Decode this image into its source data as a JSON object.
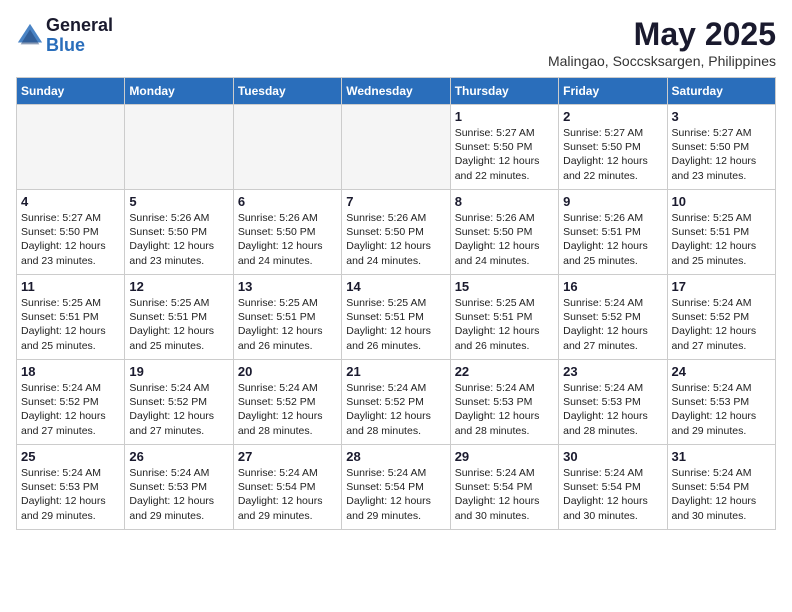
{
  "header": {
    "logo_general": "General",
    "logo_blue": "Blue",
    "month_year": "May 2025",
    "location": "Malingao, Soccsksargen, Philippines"
  },
  "weekdays": [
    "Sunday",
    "Monday",
    "Tuesday",
    "Wednesday",
    "Thursday",
    "Friday",
    "Saturday"
  ],
  "weeks": [
    [
      {
        "day": "",
        "info": ""
      },
      {
        "day": "",
        "info": ""
      },
      {
        "day": "",
        "info": ""
      },
      {
        "day": "",
        "info": ""
      },
      {
        "day": "1",
        "info": "Sunrise: 5:27 AM\nSunset: 5:50 PM\nDaylight: 12 hours\nand 22 minutes."
      },
      {
        "day": "2",
        "info": "Sunrise: 5:27 AM\nSunset: 5:50 PM\nDaylight: 12 hours\nand 22 minutes."
      },
      {
        "day": "3",
        "info": "Sunrise: 5:27 AM\nSunset: 5:50 PM\nDaylight: 12 hours\nand 23 minutes."
      }
    ],
    [
      {
        "day": "4",
        "info": "Sunrise: 5:27 AM\nSunset: 5:50 PM\nDaylight: 12 hours\nand 23 minutes."
      },
      {
        "day": "5",
        "info": "Sunrise: 5:26 AM\nSunset: 5:50 PM\nDaylight: 12 hours\nand 23 minutes."
      },
      {
        "day": "6",
        "info": "Sunrise: 5:26 AM\nSunset: 5:50 PM\nDaylight: 12 hours\nand 24 minutes."
      },
      {
        "day": "7",
        "info": "Sunrise: 5:26 AM\nSunset: 5:50 PM\nDaylight: 12 hours\nand 24 minutes."
      },
      {
        "day": "8",
        "info": "Sunrise: 5:26 AM\nSunset: 5:50 PM\nDaylight: 12 hours\nand 24 minutes."
      },
      {
        "day": "9",
        "info": "Sunrise: 5:26 AM\nSunset: 5:51 PM\nDaylight: 12 hours\nand 25 minutes."
      },
      {
        "day": "10",
        "info": "Sunrise: 5:25 AM\nSunset: 5:51 PM\nDaylight: 12 hours\nand 25 minutes."
      }
    ],
    [
      {
        "day": "11",
        "info": "Sunrise: 5:25 AM\nSunset: 5:51 PM\nDaylight: 12 hours\nand 25 minutes."
      },
      {
        "day": "12",
        "info": "Sunrise: 5:25 AM\nSunset: 5:51 PM\nDaylight: 12 hours\nand 25 minutes."
      },
      {
        "day": "13",
        "info": "Sunrise: 5:25 AM\nSunset: 5:51 PM\nDaylight: 12 hours\nand 26 minutes."
      },
      {
        "day": "14",
        "info": "Sunrise: 5:25 AM\nSunset: 5:51 PM\nDaylight: 12 hours\nand 26 minutes."
      },
      {
        "day": "15",
        "info": "Sunrise: 5:25 AM\nSunset: 5:51 PM\nDaylight: 12 hours\nand 26 minutes."
      },
      {
        "day": "16",
        "info": "Sunrise: 5:24 AM\nSunset: 5:52 PM\nDaylight: 12 hours\nand 27 minutes."
      },
      {
        "day": "17",
        "info": "Sunrise: 5:24 AM\nSunset: 5:52 PM\nDaylight: 12 hours\nand 27 minutes."
      }
    ],
    [
      {
        "day": "18",
        "info": "Sunrise: 5:24 AM\nSunset: 5:52 PM\nDaylight: 12 hours\nand 27 minutes."
      },
      {
        "day": "19",
        "info": "Sunrise: 5:24 AM\nSunset: 5:52 PM\nDaylight: 12 hours\nand 27 minutes."
      },
      {
        "day": "20",
        "info": "Sunrise: 5:24 AM\nSunset: 5:52 PM\nDaylight: 12 hours\nand 28 minutes."
      },
      {
        "day": "21",
        "info": "Sunrise: 5:24 AM\nSunset: 5:52 PM\nDaylight: 12 hours\nand 28 minutes."
      },
      {
        "day": "22",
        "info": "Sunrise: 5:24 AM\nSunset: 5:53 PM\nDaylight: 12 hours\nand 28 minutes."
      },
      {
        "day": "23",
        "info": "Sunrise: 5:24 AM\nSunset: 5:53 PM\nDaylight: 12 hours\nand 28 minutes."
      },
      {
        "day": "24",
        "info": "Sunrise: 5:24 AM\nSunset: 5:53 PM\nDaylight: 12 hours\nand 29 minutes."
      }
    ],
    [
      {
        "day": "25",
        "info": "Sunrise: 5:24 AM\nSunset: 5:53 PM\nDaylight: 12 hours\nand 29 minutes."
      },
      {
        "day": "26",
        "info": "Sunrise: 5:24 AM\nSunset: 5:53 PM\nDaylight: 12 hours\nand 29 minutes."
      },
      {
        "day": "27",
        "info": "Sunrise: 5:24 AM\nSunset: 5:54 PM\nDaylight: 12 hours\nand 29 minutes."
      },
      {
        "day": "28",
        "info": "Sunrise: 5:24 AM\nSunset: 5:54 PM\nDaylight: 12 hours\nand 29 minutes."
      },
      {
        "day": "29",
        "info": "Sunrise: 5:24 AM\nSunset: 5:54 PM\nDaylight: 12 hours\nand 30 minutes."
      },
      {
        "day": "30",
        "info": "Sunrise: 5:24 AM\nSunset: 5:54 PM\nDaylight: 12 hours\nand 30 minutes."
      },
      {
        "day": "31",
        "info": "Sunrise: 5:24 AM\nSunset: 5:54 PM\nDaylight: 12 hours\nand 30 minutes."
      }
    ]
  ]
}
